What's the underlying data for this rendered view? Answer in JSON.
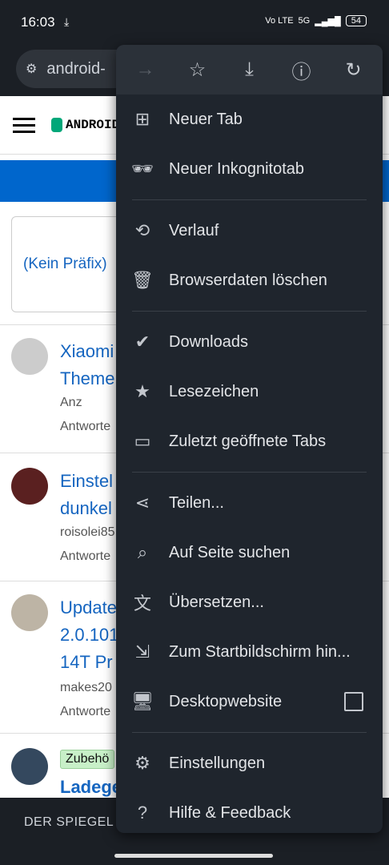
{
  "status": {
    "time": "16:03",
    "network": "5G",
    "volte": "Vo LTE",
    "battery": "54"
  },
  "url": {
    "text": "android-"
  },
  "page": {
    "logo": "ANDROID",
    "prefix": "(Kein Präfix)",
    "posts": [
      {
        "title1": "Xiaomi",
        "title2": "Theme",
        "meta1": "Anz",
        "meta2": "Antworte"
      },
      {
        "title1": "Einstel",
        "title2": "dunkel",
        "meta1": "roisolei85",
        "meta2": "Antworte"
      },
      {
        "title1": "Update",
        "title2": "2.0.101",
        "title3": "14T Pr",
        "meta1": "makes20",
        "meta2": "Antworte"
      },
      {
        "tag": "Zubehö",
        "title1": "Ladege"
      }
    ],
    "bottom": "DER SPIEGEL"
  },
  "menu": {
    "icons": [
      {
        "name": "forward-icon",
        "glyph": "→",
        "disabled": true
      },
      {
        "name": "bookmark-star-icon",
        "glyph": "☆",
        "disabled": false
      },
      {
        "name": "download-icon",
        "glyph": "⤓",
        "disabled": false
      },
      {
        "name": "info-icon",
        "glyph": "ⓘ",
        "disabled": false
      },
      {
        "name": "refresh-icon",
        "glyph": "↻",
        "disabled": false
      }
    ],
    "items": [
      {
        "label": "Neuer Tab"
      },
      {
        "label": "Neuer Inkognitotab"
      },
      {
        "label": "Verlauf"
      },
      {
        "label": "Browserdaten löschen"
      },
      {
        "label": "Downloads"
      },
      {
        "label": "Lesezeichen"
      },
      {
        "label": "Zuletzt geöffnete Tabs"
      },
      {
        "label": "Teilen..."
      },
      {
        "label": "Auf Seite suchen"
      },
      {
        "label": "Übersetzen..."
      },
      {
        "label": "Zum Startbildschirm hin..."
      },
      {
        "label": "Desktopwebsite"
      },
      {
        "label": "Einstellungen"
      },
      {
        "label": "Hilfe & Feedback"
      }
    ]
  }
}
